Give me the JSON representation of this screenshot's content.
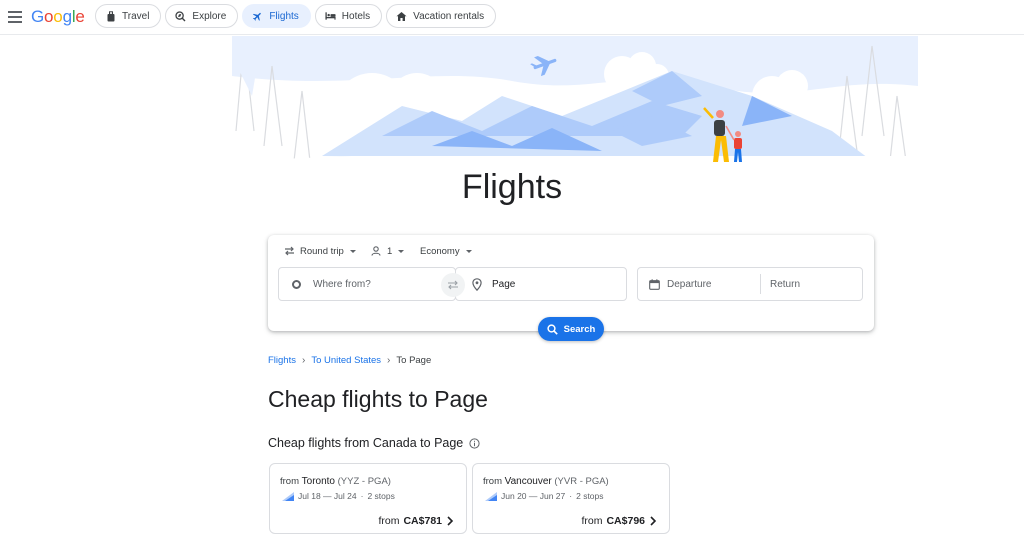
{
  "header": {
    "logo": "Google",
    "chips": [
      {
        "label": "Travel",
        "icon": "suitcase-icon"
      },
      {
        "label": "Explore",
        "icon": "explore-icon"
      },
      {
        "label": "Flights",
        "icon": "airplane-icon",
        "active": true
      },
      {
        "label": "Hotels",
        "icon": "bed-icon"
      },
      {
        "label": "Vacation rentals",
        "icon": "house-icon"
      }
    ]
  },
  "page_title": "Flights",
  "search": {
    "trip_type": "Round trip",
    "passengers": "1",
    "cabin_class": "Economy",
    "from_placeholder": "Where from?",
    "to_value": "Page",
    "departure_placeholder": "Departure",
    "return_placeholder": "Return",
    "search_label": "Search"
  },
  "breadcrumb": {
    "items": [
      "Flights",
      "To United States"
    ],
    "current": "To Page"
  },
  "section": {
    "heading": "Cheap flights to Page",
    "subheading": "Cheap flights from Canada to Page"
  },
  "cards": [
    {
      "from_label": "from",
      "city": "Toronto",
      "codes": "(YYZ - PGA)",
      "dates": "Jul 18 — Jul 24",
      "stops": "2 stops",
      "price_prefix": "from",
      "price": "CA$781"
    },
    {
      "from_label": "from",
      "city": "Vancouver",
      "codes": "(YVR - PGA)",
      "dates": "Jun 20 — Jun 27",
      "stops": "2 stops",
      "price_prefix": "from",
      "price": "CA$796"
    }
  ],
  "colors": {
    "accent": "#1a73e8",
    "hero_blue": "#aecbfa",
    "hero_light": "#e8f0fe"
  }
}
